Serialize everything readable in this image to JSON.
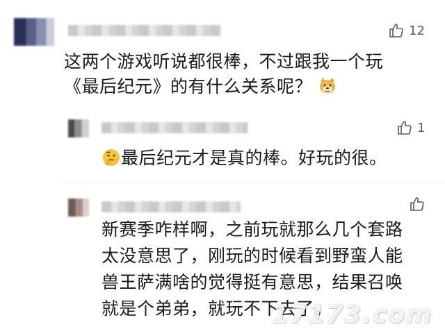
{
  "comments": [
    {
      "text_lines": [
        "这两个游戏听说都很棒，不过跟我一个玩",
        "《最后纪元》的有什么关系呢？"
      ],
      "likes": "12",
      "emoji": "doge-emoji"
    },
    {
      "text_lines": [
        "最后纪元才是真的棒。好玩的很。"
      ],
      "likes": "1",
      "emoji": "thinking-emoji"
    },
    {
      "text_lines": [
        "新赛季咋样啊，之前玩就那么几个套路",
        "太没意思了，刚玩的时候看到野蛮人能",
        "兽王萨满啥的觉得挺有意思，结果召唤",
        "就是个弟弟，就玩不下去了。"
      ],
      "likes": ""
    }
  ],
  "watermark": "17173.com",
  "colors": {
    "text": "#1a1a1a",
    "icon": "#5a5a5a",
    "background": "#ffffff"
  }
}
